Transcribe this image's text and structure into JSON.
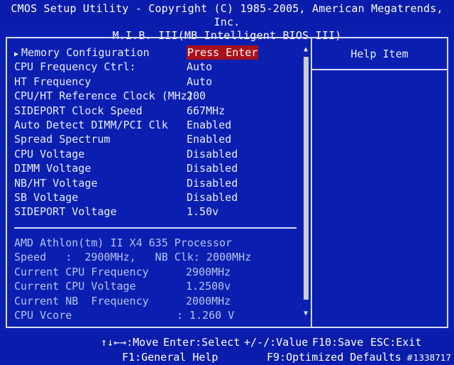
{
  "header": {
    "line1": "CMOS Setup Utility - Copyright (C) 1985-2005, American Megatrends, Inc.",
    "line2": "M.I.B. III(MB Intelligent BIOS III)"
  },
  "settings": [
    {
      "label": "Memory Configuration",
      "value": "Press Enter",
      "submenu": true
    },
    {
      "label": "CPU Frequency Ctrl:",
      "value": "Auto"
    },
    {
      "label": "HT Frequency",
      "value": "Auto"
    },
    {
      "label": "CPU/HT Reference Clock (MHz)",
      "value": "200"
    },
    {
      "label": "SIDEPORT Clock Speed",
      "value": "667MHz"
    },
    {
      "label": "Auto Detect DIMM/PCI Clk",
      "value": "Enabled"
    },
    {
      "label": "Spread Spectrum",
      "value": "Enabled"
    },
    {
      "label": "CPU Voltage",
      "value": "Disabled"
    },
    {
      "label": "DIMM Voltage",
      "value": "Disabled"
    },
    {
      "label": "NB/HT Voltage",
      "value": "Disabled"
    },
    {
      "label": "SB Voltage",
      "value": "Disabled"
    },
    {
      "label": "SIDEPORT Voltage",
      "value": "1.50v"
    }
  ],
  "processor": {
    "name": "AMD Athlon(tm) II X4 635 Processor",
    "speed_line": "Speed   :  2900MHz,   NB Clk: 2000MHz",
    "rows": [
      {
        "label": "Current CPU Frequency",
        "value": "2900MHz"
      },
      {
        "label": "Current CPU Voltage",
        "value": "1.2500v"
      },
      {
        "label": "Current NB  Frequency",
        "value": "2000MHz"
      },
      {
        "label": "CPU Vcore",
        "value": ": 1.260 V"
      }
    ]
  },
  "help": {
    "title": "Help Item"
  },
  "footer": {
    "move": "↑↓←→:Move",
    "select": "Enter:Select",
    "value": "+/-/:Value",
    "save": "F10:Save",
    "exit": "ESC:Exit",
    "general_help": "F1:General Help",
    "optimized": "F9:Optimized Defaults"
  },
  "watermark": "#1338717",
  "icons": {
    "submenu": "triangle-right-icon",
    "scroll_up": "triangle-up-icon",
    "scroll_down": "triangle-down-icon"
  },
  "colors": {
    "background": "#0a1fb0",
    "highlight": "#a8101a",
    "text": "#e8ecff",
    "dim_text": "#b8c2ec"
  }
}
